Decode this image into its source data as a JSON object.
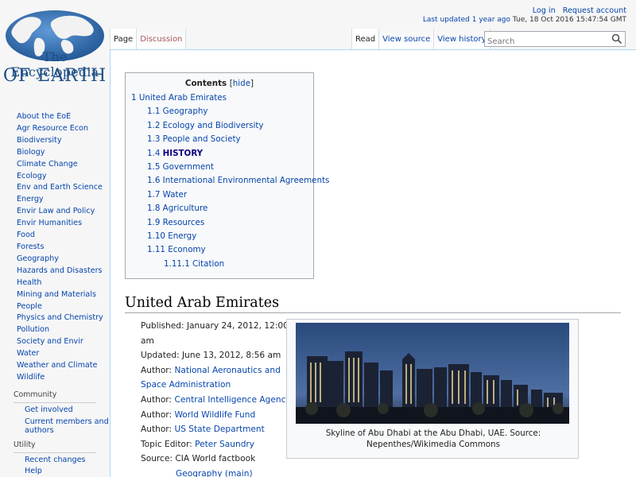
{
  "logo": {
    "line1": "The Encyclopedia",
    "line2": "OF EARTH"
  },
  "personal": {
    "login": "Log in",
    "request_account": "Request account"
  },
  "last_modified": {
    "link": "Last updated 1 year ago",
    "rest": "Tue, 18 Oct 2016 15:47:54 GMT"
  },
  "tabs": {
    "left": [
      "Page",
      "Discussion"
    ],
    "right": [
      "Read",
      "View source",
      "View history"
    ]
  },
  "search": {
    "placeholder": "Search"
  },
  "sidebar": {
    "items": [
      "About the EoE",
      "Agr Resource Econ",
      "Biodiversity",
      "Biology",
      "Climate Change",
      "Ecology",
      "Env and Earth Science",
      "Energy",
      "Envir Law and Policy",
      "Envir Humanities",
      "Food",
      "Forests",
      "Geography",
      "Hazards and Disasters",
      "Health",
      "Mining and Materials",
      "People",
      "Physics and Chemistry",
      "Pollution",
      "Society and Envir",
      "Water",
      "Weather and Climate",
      "Wildlife"
    ],
    "community": {
      "title": "Community",
      "items": [
        "Get involved",
        "Current members and authors"
      ]
    },
    "utility": {
      "title": "Utility",
      "items": [
        "Recent changes",
        "Help"
      ]
    }
  },
  "toc": {
    "title": "Contents",
    "hide": "hide",
    "entries": [
      {
        "num": "1",
        "label": "United Arab Emirates",
        "level": 1
      },
      {
        "num": "1.1",
        "label": "Geography",
        "level": 2
      },
      {
        "num": "1.2",
        "label": "Ecology and Biodiversity",
        "level": 2
      },
      {
        "num": "1.3",
        "label": "People and Society",
        "level": 2
      },
      {
        "num": "1.4",
        "label": "HISTORY",
        "level": 2,
        "current": true
      },
      {
        "num": "1.5",
        "label": "Government",
        "level": 2
      },
      {
        "num": "1.6",
        "label": "International Environmental Agreements",
        "level": 2
      },
      {
        "num": "1.7",
        "label": "Water",
        "level": 2
      },
      {
        "num": "1.8",
        "label": "Agriculture",
        "level": 2
      },
      {
        "num": "1.9",
        "label": "Resources",
        "level": 2
      },
      {
        "num": "1.10",
        "label": "Energy",
        "level": 2
      },
      {
        "num": "1.11",
        "label": "Economy",
        "level": 2
      },
      {
        "num": "1.11.1",
        "label": "Citation",
        "level": 3
      }
    ]
  },
  "article": {
    "heading": "United Arab Emirates",
    "published": "Published: January 24, 2012, 12:00",
    "published_cont": "am",
    "updated": "Updated: June 13, 2012, 8:56 am",
    "author_label": "Author:",
    "author1a": "National Aeronautics and",
    "author1b": "Space Administration",
    "author2": "Central Intelligence Agency",
    "author3": "World Wildlife Fund",
    "author4": "US State Department",
    "topic_editor_label": "Topic Editor:",
    "topic_editor": "Peter Saundry",
    "source": "Source: CIA World factbook",
    "partial_link": "Geography (main)"
  },
  "thumb": {
    "caption_line1": "Skyline of Abu Dhabi at the Abu Dhabi, UAE. Source:",
    "caption_line2": "Nepenthes/Wikimedia Commons"
  }
}
